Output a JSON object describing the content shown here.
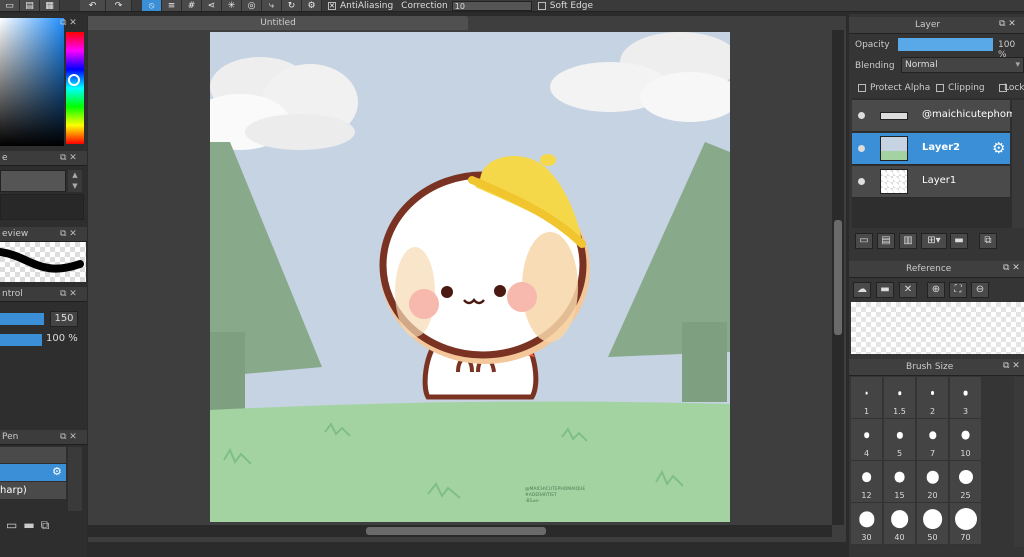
{
  "toolbar": {
    "antialiasing_label": "AntiAliasing",
    "correction_label": "Correction",
    "correction_value": "10",
    "soft_edge_label": "Soft Edge"
  },
  "document": {
    "tab_title": "Untitled"
  },
  "left_panels": {
    "panel2_title": "e",
    "preview_title": "eview",
    "control_title": "ntrol",
    "control_value1": "150",
    "control_value2": "100 %",
    "pen_title": "Pen",
    "brush_item_label": "harp)"
  },
  "layer_panel": {
    "title": "Layer",
    "opacity_label": "Opacity",
    "opacity_value": "100 %",
    "opacity_fraction": 1.0,
    "blending_label": "Blending",
    "blending_value": "Normal",
    "protect_alpha_label": "Protect Alpha",
    "clipping_label": "Clipping",
    "lock_label": "Lock",
    "layers": [
      {
        "name": "@maichicutephom",
        "selected": false
      },
      {
        "name": "Layer2",
        "selected": true
      },
      {
        "name": "Layer1",
        "selected": false
      }
    ]
  },
  "reference_panel": {
    "title": "Reference"
  },
  "brush_size_panel": {
    "title": "Brush Size",
    "sizes": [
      "1",
      "1.5",
      "2",
      "3",
      "4",
      "5",
      "7",
      "10",
      "12",
      "15",
      "20",
      "25",
      "30",
      "40",
      "50",
      "70"
    ]
  },
  "artwork": {
    "watermark_line1": "@MAICHICUTEPHOMAIQUE",
    "watermark_line2": "#ADERARTIST",
    "watermark_line3": "-B1ue-"
  },
  "colors": {
    "accent": "#3a8fd6",
    "sky": "#c5d3e3",
    "grass": "#a4d3a2",
    "tree": "#88a98a",
    "hat": "#f5d84a",
    "outline": "#7a3322"
  }
}
